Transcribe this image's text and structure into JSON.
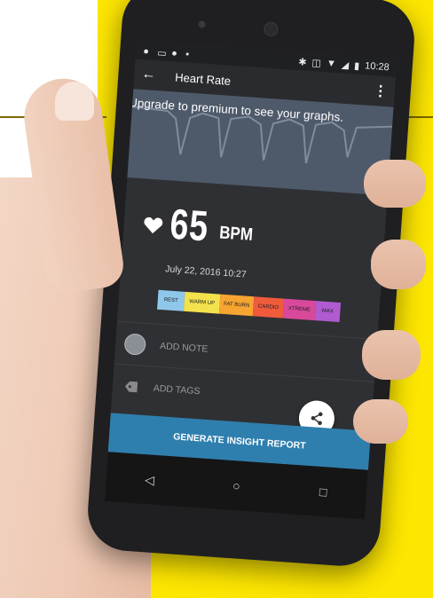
{
  "statusbar": {
    "time": "10:28"
  },
  "toolbar": {
    "title": "Heart Rate",
    "back_icon": "back-arrow-icon",
    "menu_icon": "overflow-menu-icon"
  },
  "graph": {
    "upgrade_text": "Upgrade to premium to see your graphs."
  },
  "reading": {
    "bpm": "65",
    "unit": "BPM",
    "timestamp": "July 22, 2016 10:27"
  },
  "zones": [
    {
      "label": "REST",
      "color": "#8fc7ea"
    },
    {
      "label": "WARM UP",
      "color": "#f3e24c"
    },
    {
      "label": "FAT BURN",
      "color": "#f6a531"
    },
    {
      "label": "CARDIO",
      "color": "#ef5b3b"
    },
    {
      "label": "XTREME",
      "color": "#d8499b"
    },
    {
      "label": "MAX",
      "color": "#b05bd0"
    }
  ],
  "actions": {
    "add_note": "ADD NOTE",
    "add_tags": "ADD TAGS",
    "generate": "GENERATE INSIGHT REPORT"
  },
  "colors": {
    "background": "#fde600",
    "accent": "#2f7fae",
    "screen": "#2f3033"
  }
}
